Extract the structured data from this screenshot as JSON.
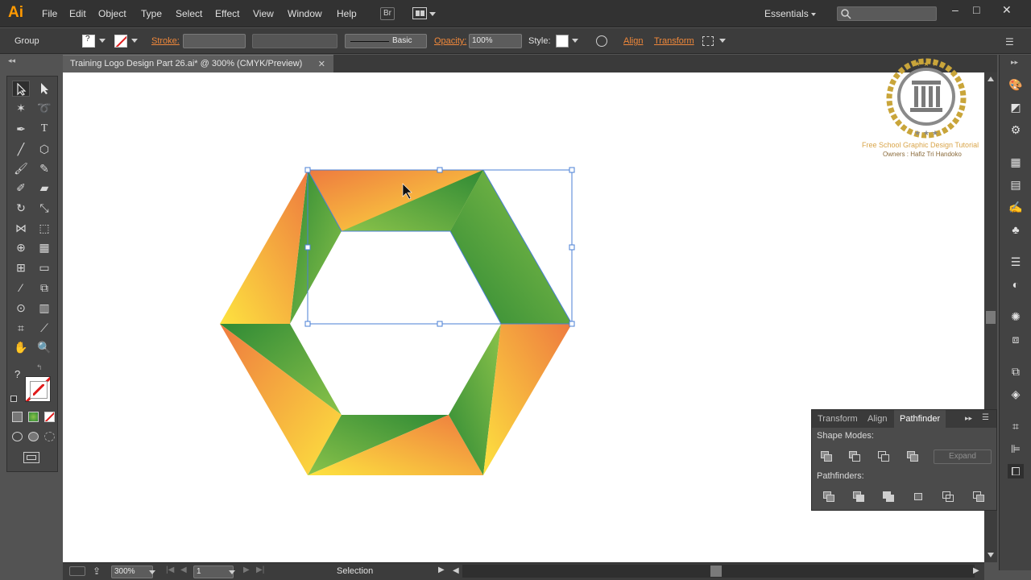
{
  "app": {
    "logo": "Ai",
    "menu": [
      "File",
      "Edit",
      "Object",
      "Type",
      "Select",
      "Effect",
      "View",
      "Window",
      "Help"
    ],
    "bridge_button": "Br",
    "workspace": "Essentials",
    "window_controls": [
      "–",
      "□",
      "✕"
    ]
  },
  "control_bar": {
    "selection_type": "Group",
    "stroke_label": "Stroke:",
    "brush_label": "Basic",
    "opacity_label": "Opacity:",
    "opacity_value": "100%",
    "style_label": "Style:",
    "align_label": "Align",
    "transform_label": "Transform"
  },
  "document": {
    "tab_title": "Training Logo Design Part 26.ai* @ 300% (CMYK/Preview)",
    "tab_close": "✕"
  },
  "watermark": {
    "line1": "Free School Graphic Design Tutorial",
    "line2": "Owners : Hafiz Tri Handoko"
  },
  "status_bar": {
    "zoom": "300%",
    "artboard": "1",
    "tool_status": "Selection"
  },
  "pathfinder_panel": {
    "tabs": [
      "Transform",
      "Align",
      "Pathfinder"
    ],
    "active_tab": "Pathfinder",
    "shape_modes_label": "Shape Modes:",
    "expand_label": "Expand",
    "pathfinders_label": "Pathfinders:"
  },
  "colors": {
    "orange": "#f0813f",
    "yellow": "#fde33f",
    "green_dark": "#2f8a35",
    "green_light": "#8bc34a",
    "selection": "#4a7fd6",
    "logo": "#ff9a00"
  },
  "toolbar_help": "?"
}
